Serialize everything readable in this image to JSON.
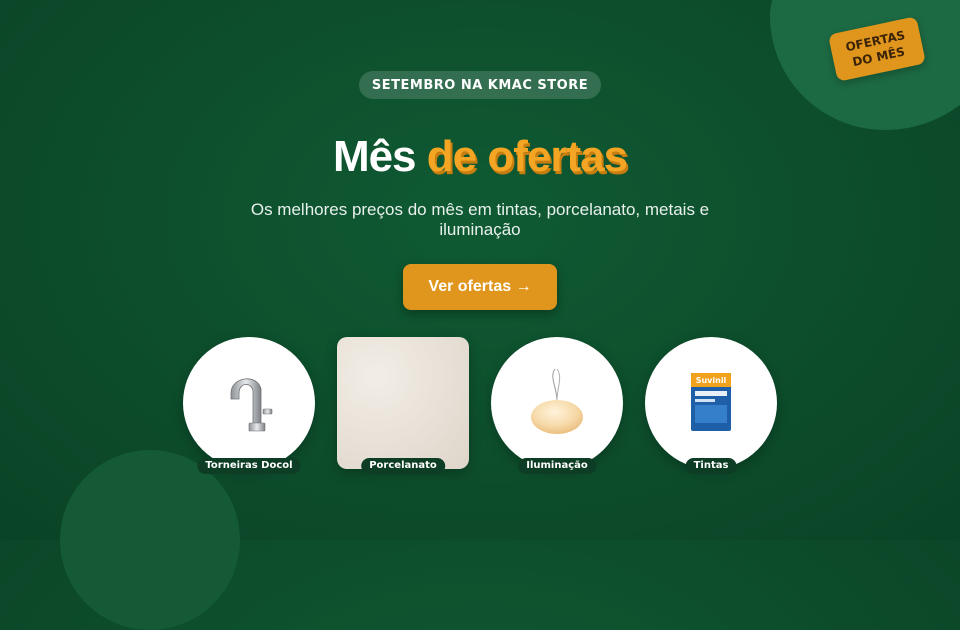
{
  "badge": {
    "line1": "OFERTAS",
    "line2": "DO MÊS"
  },
  "hero": {
    "eyebrow": "SETEMBRO NA KMAC STORE",
    "title_part1": "Mês",
    "title_part2": "de ofertas",
    "subtitle": "Os melhores preços do mês em tintas, porcelanato, metais e iluminação",
    "cta_label": "Ver ofertas →"
  },
  "categories": [
    {
      "label": "Torneiras Docol",
      "icon": "faucet-icon"
    },
    {
      "label": "Porcelanato",
      "icon": "tile-image"
    },
    {
      "label": "Iluminação",
      "icon": "pendant-lamp-icon"
    },
    {
      "label": "Tintas",
      "icon": "paint-can-icon",
      "brand": "Suvinil"
    }
  ],
  "colors": {
    "background": "#0c4a2a",
    "accent": "#e0961d"
  }
}
